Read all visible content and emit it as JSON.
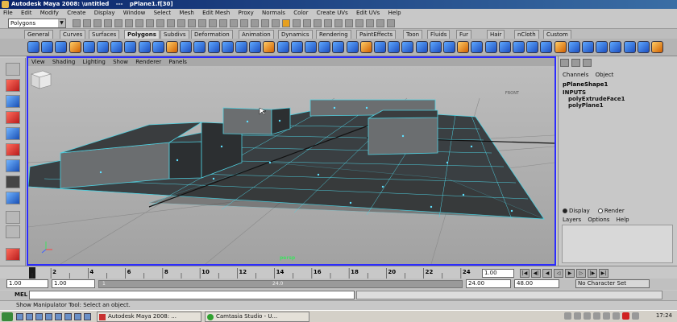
{
  "window": {
    "title_app": "Autodesk Maya 2008: ",
    "title_file": "\\untitled",
    "title_sep": "---",
    "title_object": "pPlane1.f[30]"
  },
  "menu": [
    "File",
    "Edit",
    "Modify",
    "Create",
    "Display",
    "Window",
    "Select",
    "Mesh",
    "Edit Mesh",
    "Proxy",
    "Normals",
    "Color",
    "Create UVs",
    "Edit UVs",
    "Help"
  ],
  "status_line": {
    "mode": "Polygons"
  },
  "shelf_tabs": [
    {
      "label": "General"
    },
    {
      "label": "Curves"
    },
    {
      "label": "Surfaces"
    },
    {
      "label": "Polygons",
      "active": true
    },
    {
      "label": "Subdivs"
    },
    {
      "label": "Deformation"
    },
    {
      "label": "Animation"
    },
    {
      "label": "Dynamics"
    },
    {
      "label": "Rendering"
    },
    {
      "label": "PaintEffects"
    },
    {
      "label": "Toon"
    },
    {
      "label": "Fluids"
    },
    {
      "label": "Fur"
    },
    {
      "label": "Hair"
    },
    {
      "label": "nCloth"
    },
    {
      "label": "Custom"
    }
  ],
  "viewport": {
    "menu": [
      "View",
      "Shading",
      "Lighting",
      "Show",
      "Renderer",
      "Panels"
    ],
    "camera": "persp",
    "viewcube_face": "FRONT"
  },
  "channel_box": {
    "menu": [
      "Channels",
      "Object"
    ],
    "node": "pPlaneShape1",
    "inputs_label": "INPUTS",
    "inputs": [
      "polyExtrudeFace1",
      "polyPlane1"
    ]
  },
  "layer_editor": {
    "display_label": "Display",
    "render_label": "Render",
    "menu": [
      "Layers",
      "Options",
      "Help"
    ]
  },
  "time_slider": {
    "ticks": [
      "2",
      "4",
      "6",
      "8",
      "10",
      "12",
      "14",
      "16",
      "18",
      "20",
      "22",
      "24"
    ],
    "current_frame": "1.00"
  },
  "range_slider": {
    "start": "1.00",
    "playback_start": "1.00",
    "range_start_label": "1",
    "range_end_label": "24.0",
    "playback_end": "24.00",
    "end": "48.00",
    "character_set": "No Character Set"
  },
  "command_line": {
    "label": "MEL"
  },
  "help_line": {
    "text": "Show Manipulator Tool: Select an object."
  },
  "taskbar": {
    "tasks": [
      "Autodesk Maya 2008: ...",
      "Camtasia Studio - U..."
    ],
    "clock": "17:24"
  }
}
